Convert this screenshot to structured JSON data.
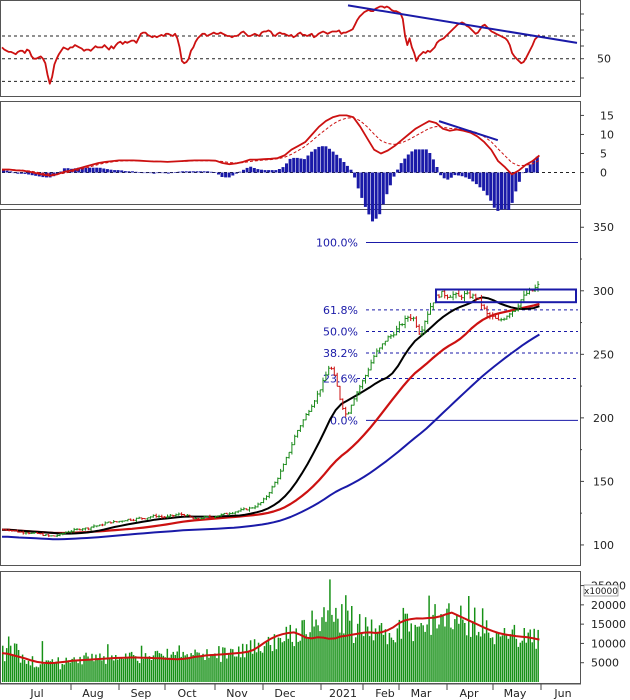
{
  "chart_data": {
    "type": "line",
    "months": [
      "Jul",
      "Aug",
      "Sep",
      "Oct",
      "Nov",
      "Dec",
      "2021",
      "Feb",
      "Mar",
      "Apr",
      "May",
      "Jun"
    ],
    "colors": {
      "price_up": "#1a8a1a",
      "price_down": "#cc1111",
      "ma_short": "#000000",
      "ma_mid": "#cc1111",
      "ma_long": "#1a1aa8",
      "volume_bar": "#169116",
      "volume_ma": "#cc1111",
      "rsi_line": "#cc1111",
      "trendline": "#1a1aa8",
      "macd_line": "#cc1111",
      "macd_hist": "#1a1aa8",
      "fib_line": "#1a1aa8"
    },
    "panels": {
      "rsi": {
        "tick_labels": [
          "50"
        ],
        "levels": [
          30,
          50,
          70
        ],
        "ylim": [
          18,
          100
        ],
        "trendline": {
          "from": [
            "mid-Jan",
            97
          ],
          "to": [
            "end-May",
            68
          ]
        },
        "series": [
          60,
          58,
          57,
          56,
          56,
          55,
          54,
          56,
          57,
          57,
          55,
          58,
          57,
          52,
          50,
          50,
          51,
          52,
          50,
          46,
          36,
          28,
          34,
          45,
          50,
          54,
          57,
          60,
          59,
          58,
          60,
          60,
          62,
          61,
          60,
          59,
          57,
          58,
          58,
          57,
          59,
          61,
          60,
          60,
          60,
          62,
          60,
          58,
          61,
          59,
          62,
          64,
          65,
          63,
          65,
          64,
          65,
          66,
          66,
          64,
          68,
          72,
          73,
          73,
          71,
          70,
          69,
          70,
          69,
          70,
          71,
          70,
          72,
          72,
          71,
          70,
          72,
          68,
          60,
          48,
          46,
          47,
          50,
          57,
          60,
          65,
          68,
          70,
          72,
          72,
          70,
          71,
          72,
          73,
          72,
          72,
          73,
          72,
          71,
          70,
          70,
          69,
          70,
          70,
          71,
          73,
          74,
          72,
          70,
          70,
          71,
          72,
          71,
          70,
          73,
          74,
          74,
          75,
          74,
          71,
          70,
          72,
          73,
          72,
          72,
          71,
          70,
          71,
          69,
          70,
          72,
          73,
          71,
          71,
          70,
          71,
          72,
          69,
          70,
          72,
          73,
          74,
          73,
          72,
          73,
          74,
          74,
          74,
          75,
          72,
          73,
          73,
          74,
          75,
          76,
          80,
          84,
          87,
          89,
          91,
          92,
          93,
          92,
          92,
          94,
          95,
          96,
          96,
          95,
          96,
          95,
          93,
          92,
          92,
          91,
          90,
          85,
          70,
          62,
          68,
          60,
          55,
          48,
          52,
          54,
          56,
          55,
          57,
          56,
          58,
          60,
          64,
          66,
          67,
          68,
          70,
          72,
          74,
          76,
          78,
          80,
          81,
          82,
          81,
          79,
          78,
          76,
          74,
          72,
          73,
          76,
          79,
          80,
          78,
          76,
          74,
          73,
          72,
          71,
          70,
          69,
          68,
          66,
          62,
          55,
          52,
          50,
          48,
          46,
          47,
          50,
          54,
          58,
          62,
          67,
          69,
          71
        ]
      },
      "macd": {
        "tick_labels": [
          "15",
          "10",
          "5",
          "0"
        ],
        "ylim": [
          -8,
          18
        ],
        "trendline": {
          "from": [
            "mid-Mar",
            13.5
          ],
          "to": [
            "late-Apr",
            8.5
          ]
        },
        "macd_series": [
          0.8,
          0.8,
          0.6,
          0.5,
          0.2,
          -0.2,
          -0.6,
          -0.8,
          -0.5,
          0.2,
          0.5,
          1,
          1.5,
          2,
          2.5,
          2.8,
          3,
          3.2,
          3.2,
          3.2,
          3.1,
          3,
          2.9,
          2.9,
          2.8,
          2.9,
          3,
          3.1,
          3.2,
          3.2,
          3.2,
          3.1,
          2.5,
          2.2,
          2.4,
          2.8,
          3.4,
          3.4,
          3.5,
          3.6,
          3.8,
          4.5,
          6,
          7,
          8,
          10,
          12,
          13.5,
          14.5,
          15,
          15,
          14.5,
          12,
          9,
          6,
          5,
          5.8,
          7,
          8.5,
          10,
          11.5,
          12.5,
          13.5,
          13,
          11.5,
          11,
          11.3,
          11,
          10.5,
          9.5,
          8,
          6,
          3,
          1.4,
          -0.5,
          0.5,
          2,
          3,
          4.5
        ],
        "signal_series": [
          0.6,
          0.7,
          0.7,
          0.6,
          0.4,
          0.1,
          -0.2,
          -0.4,
          -0.4,
          -0.2,
          0.2,
          0.6,
          1.1,
          1.6,
          2.1,
          2.5,
          2.8,
          3,
          3.1,
          3.1,
          3.1,
          3,
          3,
          2.9,
          2.9,
          2.9,
          2.9,
          3,
          3.1,
          3.1,
          3.1,
          3.1,
          2.9,
          2.6,
          2.5,
          2.6,
          2.9,
          3.1,
          3.3,
          3.4,
          3.6,
          4,
          4.8,
          5.8,
          6.9,
          8.3,
          9.9,
          11.3,
          12.7,
          13.7,
          14.3,
          14.4,
          13.6,
          12,
          10.1,
          8.4,
          7.6,
          7.4,
          7.8,
          8.6,
          9.6,
          10.6,
          11.6,
          12.1,
          11.9,
          11.6,
          11.5,
          11.3,
          11,
          10.4,
          9.4,
          8.1,
          6.2,
          4.4,
          2.6,
          1.8,
          1.9,
          2.3,
          3.2
        ]
      },
      "price": {
        "tick_labels": [
          "350",
          "300",
          "250",
          "200",
          "150",
          "100"
        ],
        "ylim": [
          85,
          362
        ],
        "fibonacci": [
          {
            "label": "100.0%",
            "value": 338
          },
          {
            "label": "61.8%",
            "value": 285
          },
          {
            "label": "50.0%",
            "value": 268
          },
          {
            "label": "38.2%",
            "value": 251
          },
          {
            "label": "23.6%",
            "value": 231
          },
          {
            "label": "0.0%",
            "value": 198
          }
        ],
        "resistance_box": {
          "from": "late-Mar",
          "to": "end-May",
          "low": 291,
          "high": 301
        },
        "close": [
          112,
          112,
          111,
          110,
          110,
          109,
          109,
          108,
          107,
          107,
          108,
          110,
          111,
          112,
          113,
          113,
          115,
          115,
          117,
          118,
          118,
          119,
          120,
          120,
          121,
          121,
          122,
          123,
          122,
          122,
          123,
          124,
          124,
          122,
          120,
          121,
          122,
          122,
          123,
          124,
          125,
          126,
          127,
          128,
          129,
          131,
          134,
          140,
          147,
          155,
          165,
          176,
          188,
          196,
          204,
          212,
          220,
          230,
          242,
          230,
          212,
          201,
          213,
          222,
          230,
          240,
          250,
          255,
          262,
          265,
          270,
          275,
          280,
          278,
          266,
          278,
          289,
          296,
          298,
          296,
          297,
          295,
          297,
          296,
          295,
          289,
          281,
          279,
          276,
          279,
          283,
          286,
          293,
          298,
          300,
          304
        ]
      },
      "volume": {
        "tick_labels": [
          "25000",
          "20000",
          "15000",
          "10000",
          "5000"
        ],
        "multiplier_label": "x10000",
        "ylim": [
          0,
          28000
        ],
        "bars": [
          9400,
          5400,
          8800,
          11800,
          9400,
          7000,
          10000,
          9900,
          8300,
          5000,
          7100,
          5700,
          4700,
          5500,
          4300,
          6700,
          3800,
          4000,
          3800,
          4600,
          10600,
          4700,
          5600,
          5600,
          5400,
          5900,
          5100,
          5300,
          6400,
          3300,
          4700,
          4500,
          6300,
          5600,
          5000,
          6000,
          6400,
          5800,
          4900,
          6500,
          4600,
          6900,
          7600,
          6600,
          5800,
          7300,
          5400,
          7100,
          5800,
          7400,
          5600,
          6700,
          4700,
          9800,
          6100,
          6900,
          5600,
          7000,
          5800,
          6100,
          6300,
          6000,
          7400,
          6200,
          7600,
          7800,
          7000,
          6700,
          5500,
          4900,
          9400,
          6000,
          7500,
          6300,
          6700,
          5700,
          6900,
          8000,
          8100,
          7500,
          7300,
          6800,
          6400,
          8600,
          6300,
          7100,
          7800,
          7000,
          7900,
          9500,
          6500,
          7800,
          6900,
          7200,
          6500,
          7500,
          7000,
          8400,
          7700,
          7600,
          6800,
          7300,
          5700,
          8500,
          6300,
          7200,
          7200,
          7400,
          6200,
          9300,
          5200,
          9000,
          8900,
          6100,
          7300,
          8600,
          8500,
          6600,
          6600,
          9200,
          6400,
          9900,
          6400,
          9800,
          7900,
          10800,
          7300,
          11100,
          7700,
          10200,
          8000,
          7600,
          9300,
          10300,
          11700,
          9600,
          8000,
          12400,
          8500,
          11500,
          11400,
          10300,
          10600,
          14300,
          11200,
          14800,
          10400,
          9300,
          13900,
          10400,
          10700,
          16000,
          16100,
          12400,
          11200,
          12900,
          18500,
          14400,
          16200,
          14700,
          13200,
          16800,
          19400,
          15600,
          18600,
          26600,
          17400,
          15600,
          19200,
          16400,
          12800,
          20200,
          12600,
          22500,
          18500,
          15900,
          19700,
          10100,
          11600,
          15100,
          17600,
          12500,
          11900,
          16800,
          14400,
          11900,
          16200,
          10800,
          13900,
          12800,
          14700,
          15300,
          12200,
          13700,
          9800,
          12700,
          11500,
          10900,
          10300,
          13900,
          16100,
          11200,
          19200,
          17700,
          17700,
          13100,
          15200,
          10600,
          14800,
          14300,
          14400,
          15300,
          14700,
          13000,
          14900,
          22400,
          12200,
          17400,
          20200,
          13900,
          14900,
          17600,
          17500,
          14400,
          19000,
          20400,
          14100,
          13700,
          16300,
          17400,
          15100,
          19800,
          16200,
          15300,
          12100,
          22300,
          11700,
          15800,
          19300,
          12100,
          13000,
          11800,
          19100,
          12600,
          16000,
          12800,
          11400,
          11600,
          9800,
          13000,
          12500,
          11800,
          12100,
          14000,
          12200,
          11200,
          12400,
          13600,
          14800,
          11200,
          9100,
          10200,
          10700,
          14000,
          10200,
          12800,
          13600,
          10300,
          13800,
          8600,
          13500
        ],
        "ma": [
          7500,
          7300,
          6900,
          6500,
          6100,
          5600,
          5200,
          5000,
          4900,
          4950,
          5100,
          5300,
          5500,
          5600,
          5700,
          5800,
          5900,
          6000,
          6100,
          6200,
          6250,
          6300,
          6350,
          6350,
          6300,
          6300,
          6200,
          6150,
          6050,
          5950,
          5900,
          6000,
          6200,
          6500,
          6700,
          6900,
          7000,
          7100,
          7200,
          7300,
          7450,
          7600,
          7800,
          8300,
          9200,
          10300,
          11200,
          11900,
          12400,
          12700,
          12850,
          12300,
          11500,
          11300,
          11600,
          11500,
          11200,
          11300,
          11800,
          12000,
          12300,
          12550,
          12800,
          12850,
          12700,
          12900,
          13400,
          14200,
          15300,
          16000,
          16300,
          16500,
          16450,
          16600,
          16700,
          17000,
          17550,
          18000,
          17300,
          16600,
          15900,
          15200,
          14500,
          13800,
          13200,
          12700,
          12350,
          12100,
          11900,
          11750,
          11600,
          11300,
          11000
        ]
      }
    }
  }
}
